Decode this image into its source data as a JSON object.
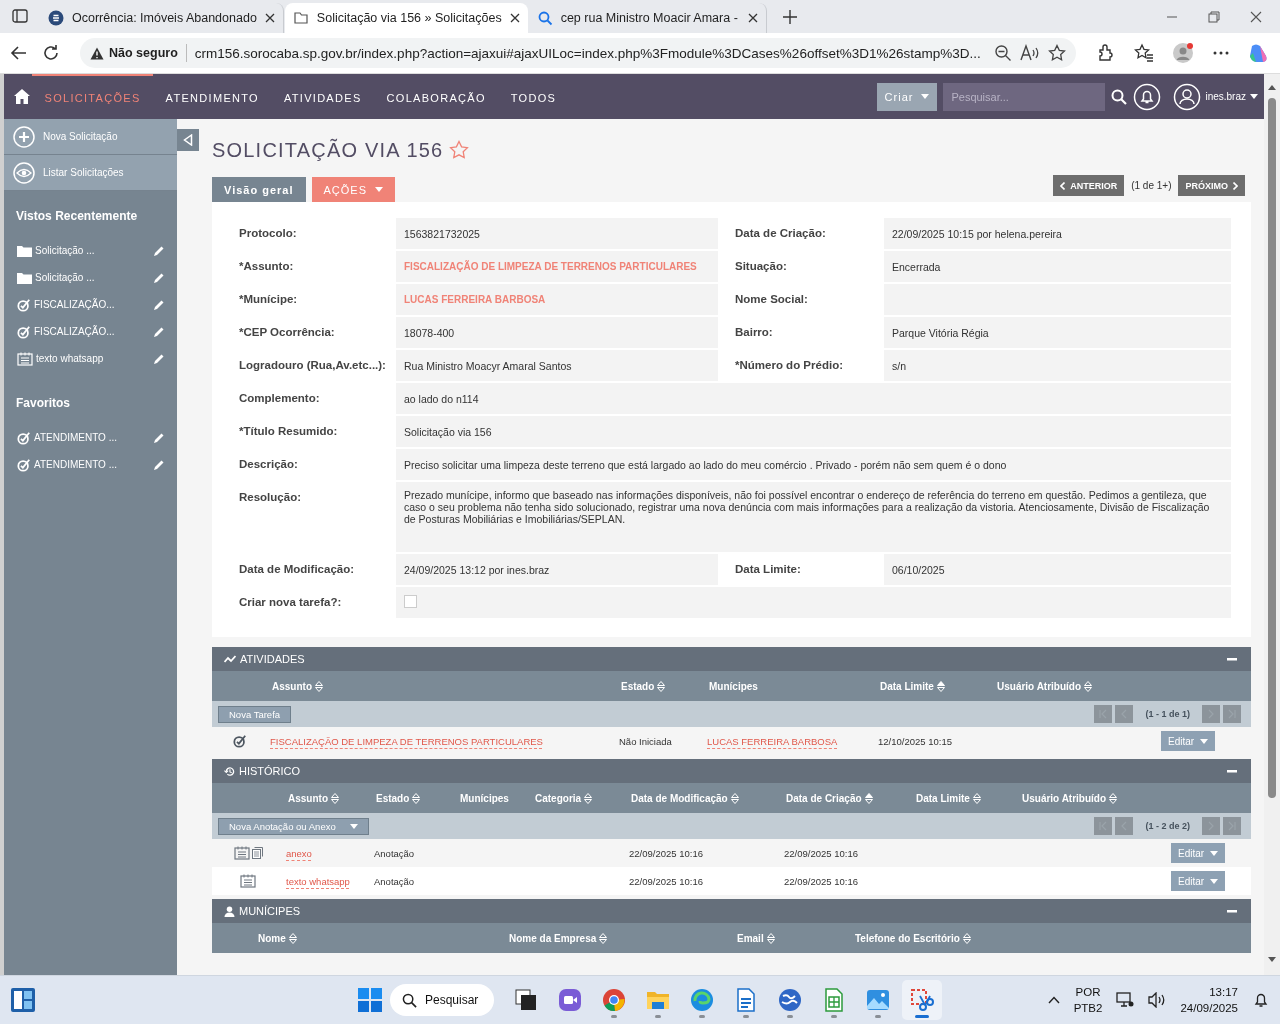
{
  "browser": {
    "tabs": [
      {
        "title": "Ocorrência: Imóveis Abandonado",
        "kind": "site",
        "selected": false
      },
      {
        "title": "Solicitação via 156 » Solicitações",
        "kind": "page",
        "selected": true
      },
      {
        "title": "cep rua Ministro Moacir Amara -",
        "kind": "search",
        "selected": false
      }
    ],
    "security": "Não seguro",
    "url": "crm156.sorocaba.sp.gov.br/index.php?action=ajaxui#ajaxUILoc=index.php%3Fmodule%3DCases%26offset%3D1%26stamp%3D..."
  },
  "nav": {
    "items": [
      {
        "label": "SOLICITAÇÕES",
        "selected": true
      },
      {
        "label": "ATENDIMENTO",
        "selected": false
      },
      {
        "label": "ATIVIDADES",
        "selected": false
      },
      {
        "label": "COLABORAÇÃO",
        "selected": false
      },
      {
        "label": "TODOS",
        "selected": false
      }
    ],
    "create": "Criar",
    "search_placeholder": "Pesquisar...",
    "user": "ines.braz"
  },
  "sidebar": {
    "actions": [
      {
        "label": "Nova Solicitação",
        "kind": "add"
      },
      {
        "label": "Listar Solicitações",
        "kind": "view"
      }
    ],
    "recent_title": "Vistos Recentemente",
    "recent": [
      {
        "label": "Solicitação ...",
        "kind": "folder"
      },
      {
        "label": "Solicitação ...",
        "kind": "folder"
      },
      {
        "label": "FISCALIZAÇÃO...",
        "kind": "task"
      },
      {
        "label": "FISCALIZAÇÃO...",
        "kind": "task"
      },
      {
        "label": "texto whatsapp",
        "kind": "note"
      }
    ],
    "favorites_title": "Favoritos",
    "favorites": [
      {
        "label": "ATENDIMENTO ...",
        "kind": "task"
      },
      {
        "label": "ATENDIMENTO ...",
        "kind": "task"
      }
    ]
  },
  "record": {
    "title": "SOLICITAÇÃO VIA 156",
    "favorite": false,
    "tabs": [
      {
        "label": "Visão geral",
        "selected": true
      }
    ],
    "actions": "AÇÕES",
    "pager": {
      "previous": "ANTERIOR",
      "count": "(1 de 1+)",
      "next": "PRÓXIMO"
    },
    "rows": [
      {
        "fields": [
          {
            "label": "Protocolo:",
            "value": "1563821732025",
            "kind": "text"
          },
          {
            "label": "Data de Criação:",
            "value": "22/09/2025 10:15 por helena.pereira",
            "kind": "text"
          }
        ]
      },
      {
        "fields": [
          {
            "label": "*Assunto:",
            "value": "FISCALIZAÇÃO DE LIMPEZA DE TERRENOS PARTICULARES",
            "kind": "link"
          },
          {
            "label": "Situação:",
            "value": "Encerrada",
            "kind": "text"
          }
        ]
      },
      {
        "fields": [
          {
            "label": "*Munícipe:",
            "value": "LUCAS FERREIRA BARBOSA",
            "kind": "link"
          },
          {
            "label": "Nome Social:",
            "kind": "text"
          }
        ]
      },
      {
        "fields": [
          {
            "label": "*CEP Ocorrência:",
            "value": "18078-400",
            "kind": "text"
          },
          {
            "label": "Bairro:",
            "value": "Parque Vitória Régia",
            "kind": "text"
          }
        ]
      },
      {
        "fields": [
          {
            "label": "Logradouro (Rua,Av.etc...):",
            "value": "Rua Ministro Moacyr Amaral Santos",
            "kind": "text"
          },
          {
            "label": "*Número do Prédio:",
            "value": "s/n",
            "kind": "text"
          }
        ]
      },
      {
        "fields": [
          {
            "label": "Complemento:",
            "value": "ao lado do n114",
            "kind": "text"
          }
        ]
      },
      {
        "fields": [
          {
            "label": "*Título Resumido:",
            "value": "Solicitação via 156",
            "kind": "text"
          }
        ]
      },
      {
        "fields": [
          {
            "label": "Descrição:",
            "value": "Preciso solicitar uma limpeza deste terreno que está largado ao lado do meu comércio . Privado - porém não sem quem é o dono",
            "kind": "text"
          }
        ]
      },
      {
        "fields": [
          {
            "label": "Resolução:",
            "value": "Prezado munícipe, informo que baseado nas informações disponíveis, não foi possível encontrar o endereço de referência do terreno em questão. Pedimos a gentileza, que caso o seu problema não tenha sido solucionado, registrar uma nova denúncia com mais informações para a realização da vistoria. Atenciosamente, Divisão de Fiscalização de Posturas Mobiliárias e Imobiliárias/SEPLAN.",
            "kind": "text"
          }
        ]
      },
      {
        "fields": [
          {
            "label": "Data de Modificação:",
            "value": "24/09/2025 13:12 por ines.braz",
            "kind": "text"
          },
          {
            "label": "Data Limite:",
            "value": "06/10/2025",
            "kind": "text"
          }
        ]
      },
      {
        "fields": [
          {
            "label": "Criar nova tarefa?:",
            "kind": "checkbox",
            "checked": false
          }
        ]
      }
    ]
  },
  "subpanels": [
    {
      "title": "ATIVIDADES",
      "kind": "activities",
      "expanded": true,
      "columns": [
        {
          "label": "Assunto",
          "sortable": true,
          "sorted": false
        },
        {
          "label": "Estado",
          "sortable": true,
          "sorted": false
        },
        {
          "label": "Munícipes",
          "sortable": false
        },
        {
          "label": "Data Limite",
          "sortable": true,
          "sorted": true
        },
        {
          "label": "Usuário Atribuído",
          "sortable": true,
          "sorted": false
        }
      ],
      "button": {
        "label": "Nova Tarefa",
        "dropdown": false
      },
      "pager": "(1 - 1 de 1)",
      "rows": [
        {
          "kind": "task",
          "cells": [
            {
              "text": "FISCALIZAÇÃO DE LIMPEZA DE TERRENOS PARTICULARES",
              "link": true
            },
            {
              "text": "Não Iniciada",
              "link": false
            },
            {
              "text": "LUCAS FERREIRA BARBOSA",
              "link": true
            },
            {
              "text": "12/10/2025 10:15",
              "link": false
            },
            null
          ],
          "edit": "Editar"
        }
      ]
    },
    {
      "title": "HISTÓRICO",
      "kind": "history",
      "expanded": true,
      "columns": [
        {
          "label": "Assunto",
          "sortable": true,
          "sorted": false
        },
        {
          "label": "Estado",
          "sortable": true,
          "sorted": false
        },
        {
          "label": "Munícipes",
          "sortable": false
        },
        {
          "label": "Categoria",
          "sortable": true,
          "sorted": false
        },
        {
          "label": "Data de Modificação",
          "sortable": true,
          "sorted": false
        },
        {
          "label": "Data de Criação",
          "sortable": true,
          "sorted": true
        },
        {
          "label": "Data Limite",
          "sortable": true,
          "sorted": false
        },
        {
          "label": "Usuário Atribuído",
          "sortable": true,
          "sorted": false
        }
      ],
      "button": {
        "label": "Nova Anotação ou Anexo",
        "dropdown": true
      },
      "pager": "(1 - 2 de 2)",
      "rows": [
        {
          "kind": "note_attachment",
          "cells": [
            {
              "text": "anexo",
              "link": true
            },
            {
              "text": "Anotação",
              "link": false
            },
            null,
            null,
            {
              "text": "22/09/2025 10:16",
              "link": false
            },
            {
              "text": "22/09/2025 10:16",
              "link": false
            },
            null,
            null
          ],
          "edit": "Editar"
        },
        {
          "kind": "note",
          "cells": [
            {
              "text": "texto whatsapp",
              "link": true
            },
            {
              "text": "Anotação",
              "link": false
            },
            null,
            null,
            {
              "text": "22/09/2025 10:16",
              "link": false
            },
            {
              "text": "22/09/2025 10:16",
              "link": false
            },
            null,
            null
          ],
          "edit": "Editar"
        }
      ]
    },
    {
      "title": "MUNÍCIPES",
      "kind": "contacts",
      "expanded": true,
      "columns": [
        {
          "label": "Nome",
          "sortable": true,
          "sorted": false
        },
        {
          "label": "Nome da Empresa",
          "sortable": true,
          "sorted": false
        },
        {
          "label": "Email",
          "sortable": true,
          "sorted": false
        },
        {
          "label": "Telefone do Escritório",
          "sortable": true,
          "sorted": false
        }
      ]
    }
  ],
  "taskbar": {
    "search": "Pesquisar",
    "apps": [
      {
        "kind": "taskview",
        "running": false,
        "selected": false
      },
      {
        "kind": "meet",
        "running": false,
        "selected": false
      },
      {
        "kind": "chrome",
        "running": true,
        "selected": false
      },
      {
        "kind": "files",
        "running": true,
        "selected": false
      },
      {
        "kind": "edge",
        "running": true,
        "selected": false
      },
      {
        "kind": "writer",
        "running": true,
        "selected": false
      },
      {
        "kind": "globe",
        "running": true,
        "selected": false
      },
      {
        "kind": "calc",
        "running": true,
        "selected": false
      },
      {
        "kind": "photos",
        "running": true,
        "selected": false
      },
      {
        "kind": "snip",
        "running": true,
        "selected": true
      }
    ],
    "language": "POR",
    "layout": "PTB2",
    "time": "13:17",
    "date": "24/09/2025"
  }
}
